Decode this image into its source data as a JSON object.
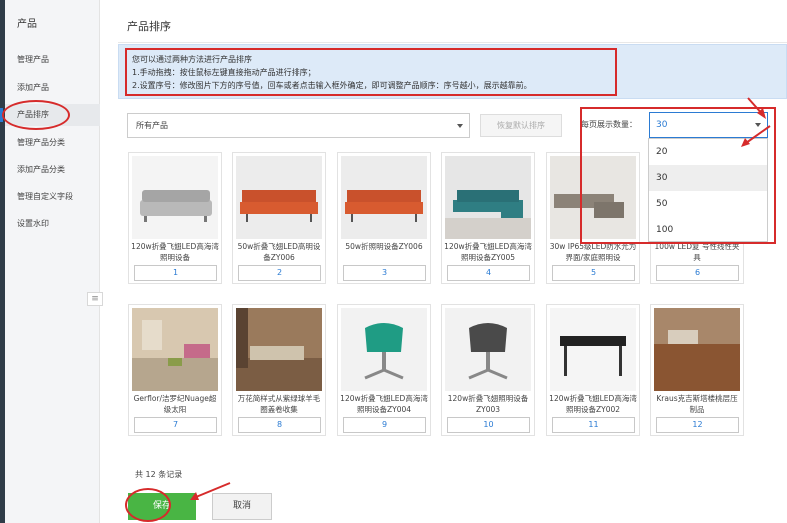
{
  "sidebar": {
    "title": "产品",
    "items": [
      {
        "label": "管理产品"
      },
      {
        "label": "添加产品"
      },
      {
        "label": "产品排序"
      },
      {
        "label": "管理产品分类"
      },
      {
        "label": "添加产品分类"
      },
      {
        "label": "管理自定义字段"
      },
      {
        "label": "设置水印"
      }
    ],
    "collapse_icon": "list-icon"
  },
  "page": {
    "title": "产品排序"
  },
  "notice": {
    "lines": [
      "您可以通过两种方法进行产品排序",
      "1.手动拖拽：按住鼠标左键直接拖动产品进行排序；",
      "2.设置序号：修改图片下方的序号值，回车或者点击输入框外确定，即可调整产品顺序：序号越小，展示越靠前。"
    ]
  },
  "toolbar": {
    "category_value": "所有产品",
    "restore_label": "恢复默认排序",
    "perpage_label": "每页展示数量：",
    "perpage_value": "30",
    "perpage_options": [
      "20",
      "30",
      "50",
      "100"
    ],
    "perpage_selected": "30"
  },
  "products": [
    {
      "name": "120w折叠飞翅LED高海湾照明设备",
      "order": "1",
      "image": "gray-sofa"
    },
    {
      "name": "50w折叠飞翅LED高明设备ZY006",
      "order": "2",
      "image": "orange-sofa"
    },
    {
      "name": "50w折照明设备ZY006",
      "order": "3",
      "image": "orange-sofa"
    },
    {
      "name": "120w折叠飞翅LED高海湾照明设备ZY005",
      "order": "4",
      "image": "teal-sofa"
    },
    {
      "name": "30w IP65级LED防水光为界面/家庭照明设",
      "order": "5",
      "image": "sectional-sofa"
    },
    {
      "name": "100w LED复 号性线性夹具",
      "order": "6",
      "image": "blank"
    },
    {
      "name": "Gerflor/洁罗纪Nuage超级太阳",
      "order": "7",
      "image": "room-floor"
    },
    {
      "name": "万花简样式从紫绿球羊毛圈盖卷收集",
      "order": "8",
      "image": "living-room"
    },
    {
      "name": "120w折叠飞翅LED高海湾照明设备ZY004",
      "order": "9",
      "image": "teal-chair"
    },
    {
      "name": "120w折叠飞翅照明设备ZY003",
      "order": "10",
      "image": "gray-chair"
    },
    {
      "name": "120w折叠飞翅LED高海湾照明设备ZY002",
      "order": "11",
      "image": "black-table"
    },
    {
      "name": "Kraus克吉斯塔楼桃层压制品",
      "order": "12",
      "image": "wood-floor"
    }
  ],
  "footer": {
    "total": "共 12 条记录",
    "save_label": "保存",
    "cancel_label": "取消"
  },
  "colors": {
    "annotation_red": "#d62b2b",
    "accent_blue": "#2b7bd3",
    "save_green": "#49b544",
    "notice_bg": "#ddeaf8"
  }
}
